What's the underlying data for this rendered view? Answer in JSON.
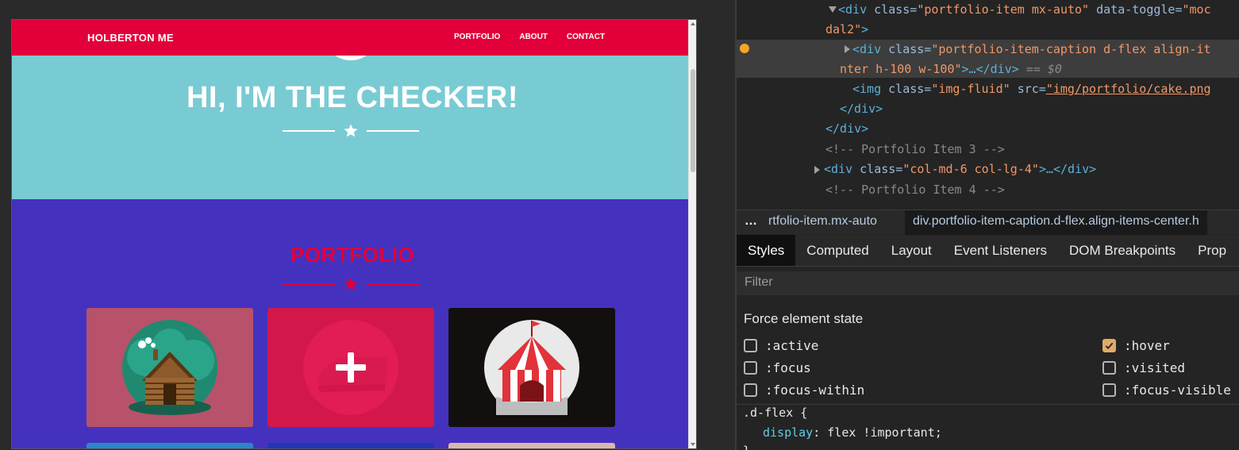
{
  "site": {
    "brand": "HOLBERTON ME",
    "nav": [
      "PORTFOLIO",
      "ABOUT",
      "CONTACT"
    ],
    "hero_title": "HI, I'M THE CHECKER!",
    "portfolio_heading": "PORTFOLIO",
    "colors": {
      "navbar": "#e3003a",
      "hero": "#79cbd3",
      "portfolio": "#4432bf",
      "heading": "#e3003a"
    },
    "cards": [
      {
        "name": "cabin",
        "color": "#b8526a"
      },
      {
        "name": "cake",
        "color": "#d2174b"
      },
      {
        "name": "circus",
        "color": "#130f0f"
      }
    ]
  },
  "devtools": {
    "dom": {
      "l1_open": "<div",
      "l1_attr1": " class=",
      "l1_val1": "\"portfolio-item mx-auto\"",
      "l1_attr2": " data-toggle=",
      "l1_val2": "\"moc",
      "l2": "dal2\"",
      "l2_close": ">",
      "l3_open": "<div",
      "l3_attr": " class=",
      "l3_val": "\"portfolio-item-caption d-flex align-it",
      "l4_val": "nter h-100 w-100\"",
      "l4_rest": ">…</div>",
      "l4_eq": " == ",
      "l4_ref": "$0",
      "l5_open": "<img",
      "l5_attr1": " class=",
      "l5_val1": "\"img-fluid\"",
      "l5_attr2": " src=",
      "l5_val2": "\"img/portfolio/cake.png",
      "l6": "</div>",
      "l7": "</div>",
      "l8": "<!-- Portfolio Item 3 -->",
      "l9_open": "<div",
      "l9_attr": " class=",
      "l9_val": "\"col-md-6 col-lg-4\"",
      "l9_rest": ">…</div>",
      "l10": "<!-- Portfolio Item 4 -->"
    },
    "breadcrumb": {
      "more": "…",
      "item1": "rtfolio-item.mx-auto",
      "item2": "div.portfolio-item-caption.d-flex.align-items-center.h"
    },
    "tabs": [
      "Styles",
      "Computed",
      "Layout",
      "Event Listeners",
      "DOM Breakpoints",
      "Prop"
    ],
    "active_tab": "Styles",
    "filter_placeholder": "Filter",
    "force_state_title": "Force element state",
    "states_left": [
      {
        "label": ":active",
        "checked": false
      },
      {
        "label": ":focus",
        "checked": false
      },
      {
        "label": ":focus-within",
        "checked": false
      }
    ],
    "states_right": [
      {
        "label": ":hover",
        "checked": true
      },
      {
        "label": ":visited",
        "checked": false
      },
      {
        "label": ":focus-visible",
        "checked": false
      }
    ],
    "css": {
      "selector": ".d-flex {",
      "property": "display",
      "colon": ": ",
      "value": "flex !important",
      "semicolon": ";",
      "close": "}"
    }
  }
}
